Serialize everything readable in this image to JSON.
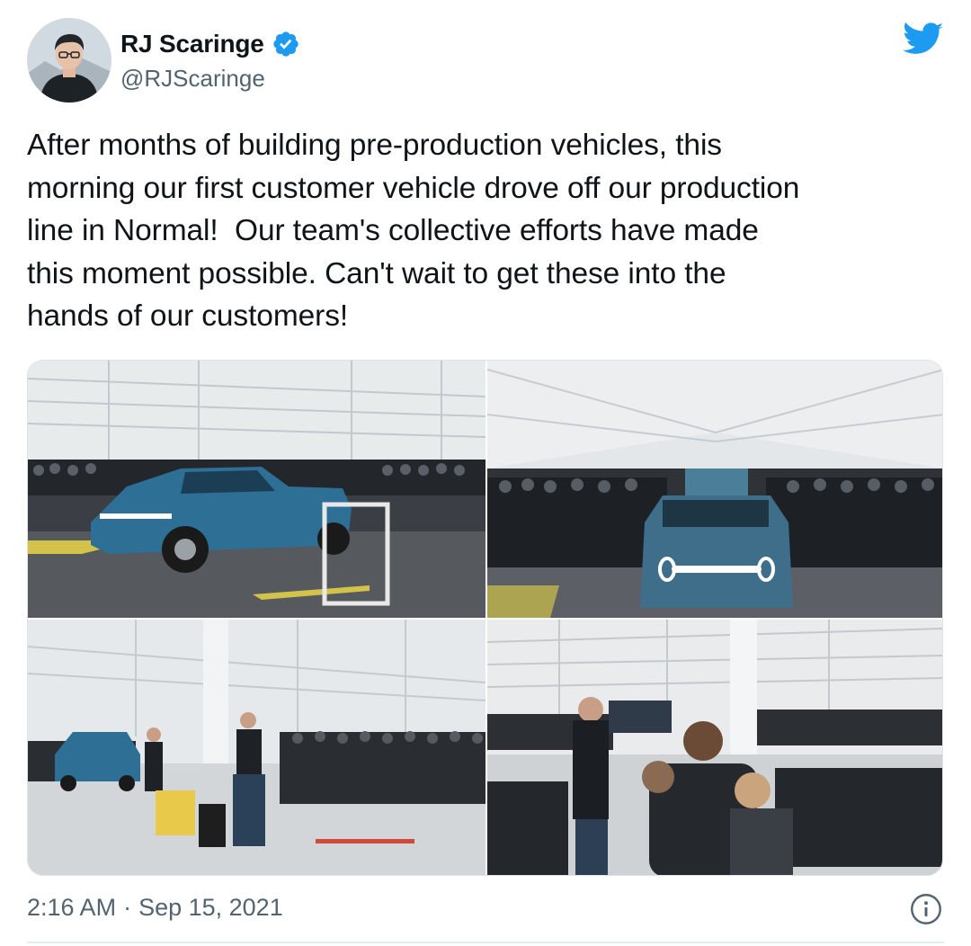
{
  "author": {
    "display_name": "RJ Scaringe",
    "handle": "@RJScaringe",
    "verified": true
  },
  "tweet": {
    "text": "After months of building pre-production vehicles, this\nmorning our first customer vehicle drove off our production\nline in Normal!  Our team's collective efforts have made\nthis moment possible. Can't wait to get these into the\nhands of our customers!",
    "time": "2:16 AM",
    "separator": "·",
    "date": "Sep 15, 2021"
  },
  "icons": {
    "brand": "twitter-bird-icon",
    "verified": "verified-badge-icon",
    "info": "info-icon"
  },
  "colors": {
    "twitter_blue": "#1d9bf0",
    "truck_blue": "#2e6f96",
    "secondary_text": "#536471"
  },
  "media": {
    "count": 4,
    "photos": [
      {
        "subject": "blue pickup truck in factory with crowd"
      },
      {
        "subject": "blue SUV front view in factory with crowd"
      },
      {
        "subject": "presenter speaking to crowd in factory"
      },
      {
        "subject": "children watching presenter in factory"
      }
    ]
  }
}
